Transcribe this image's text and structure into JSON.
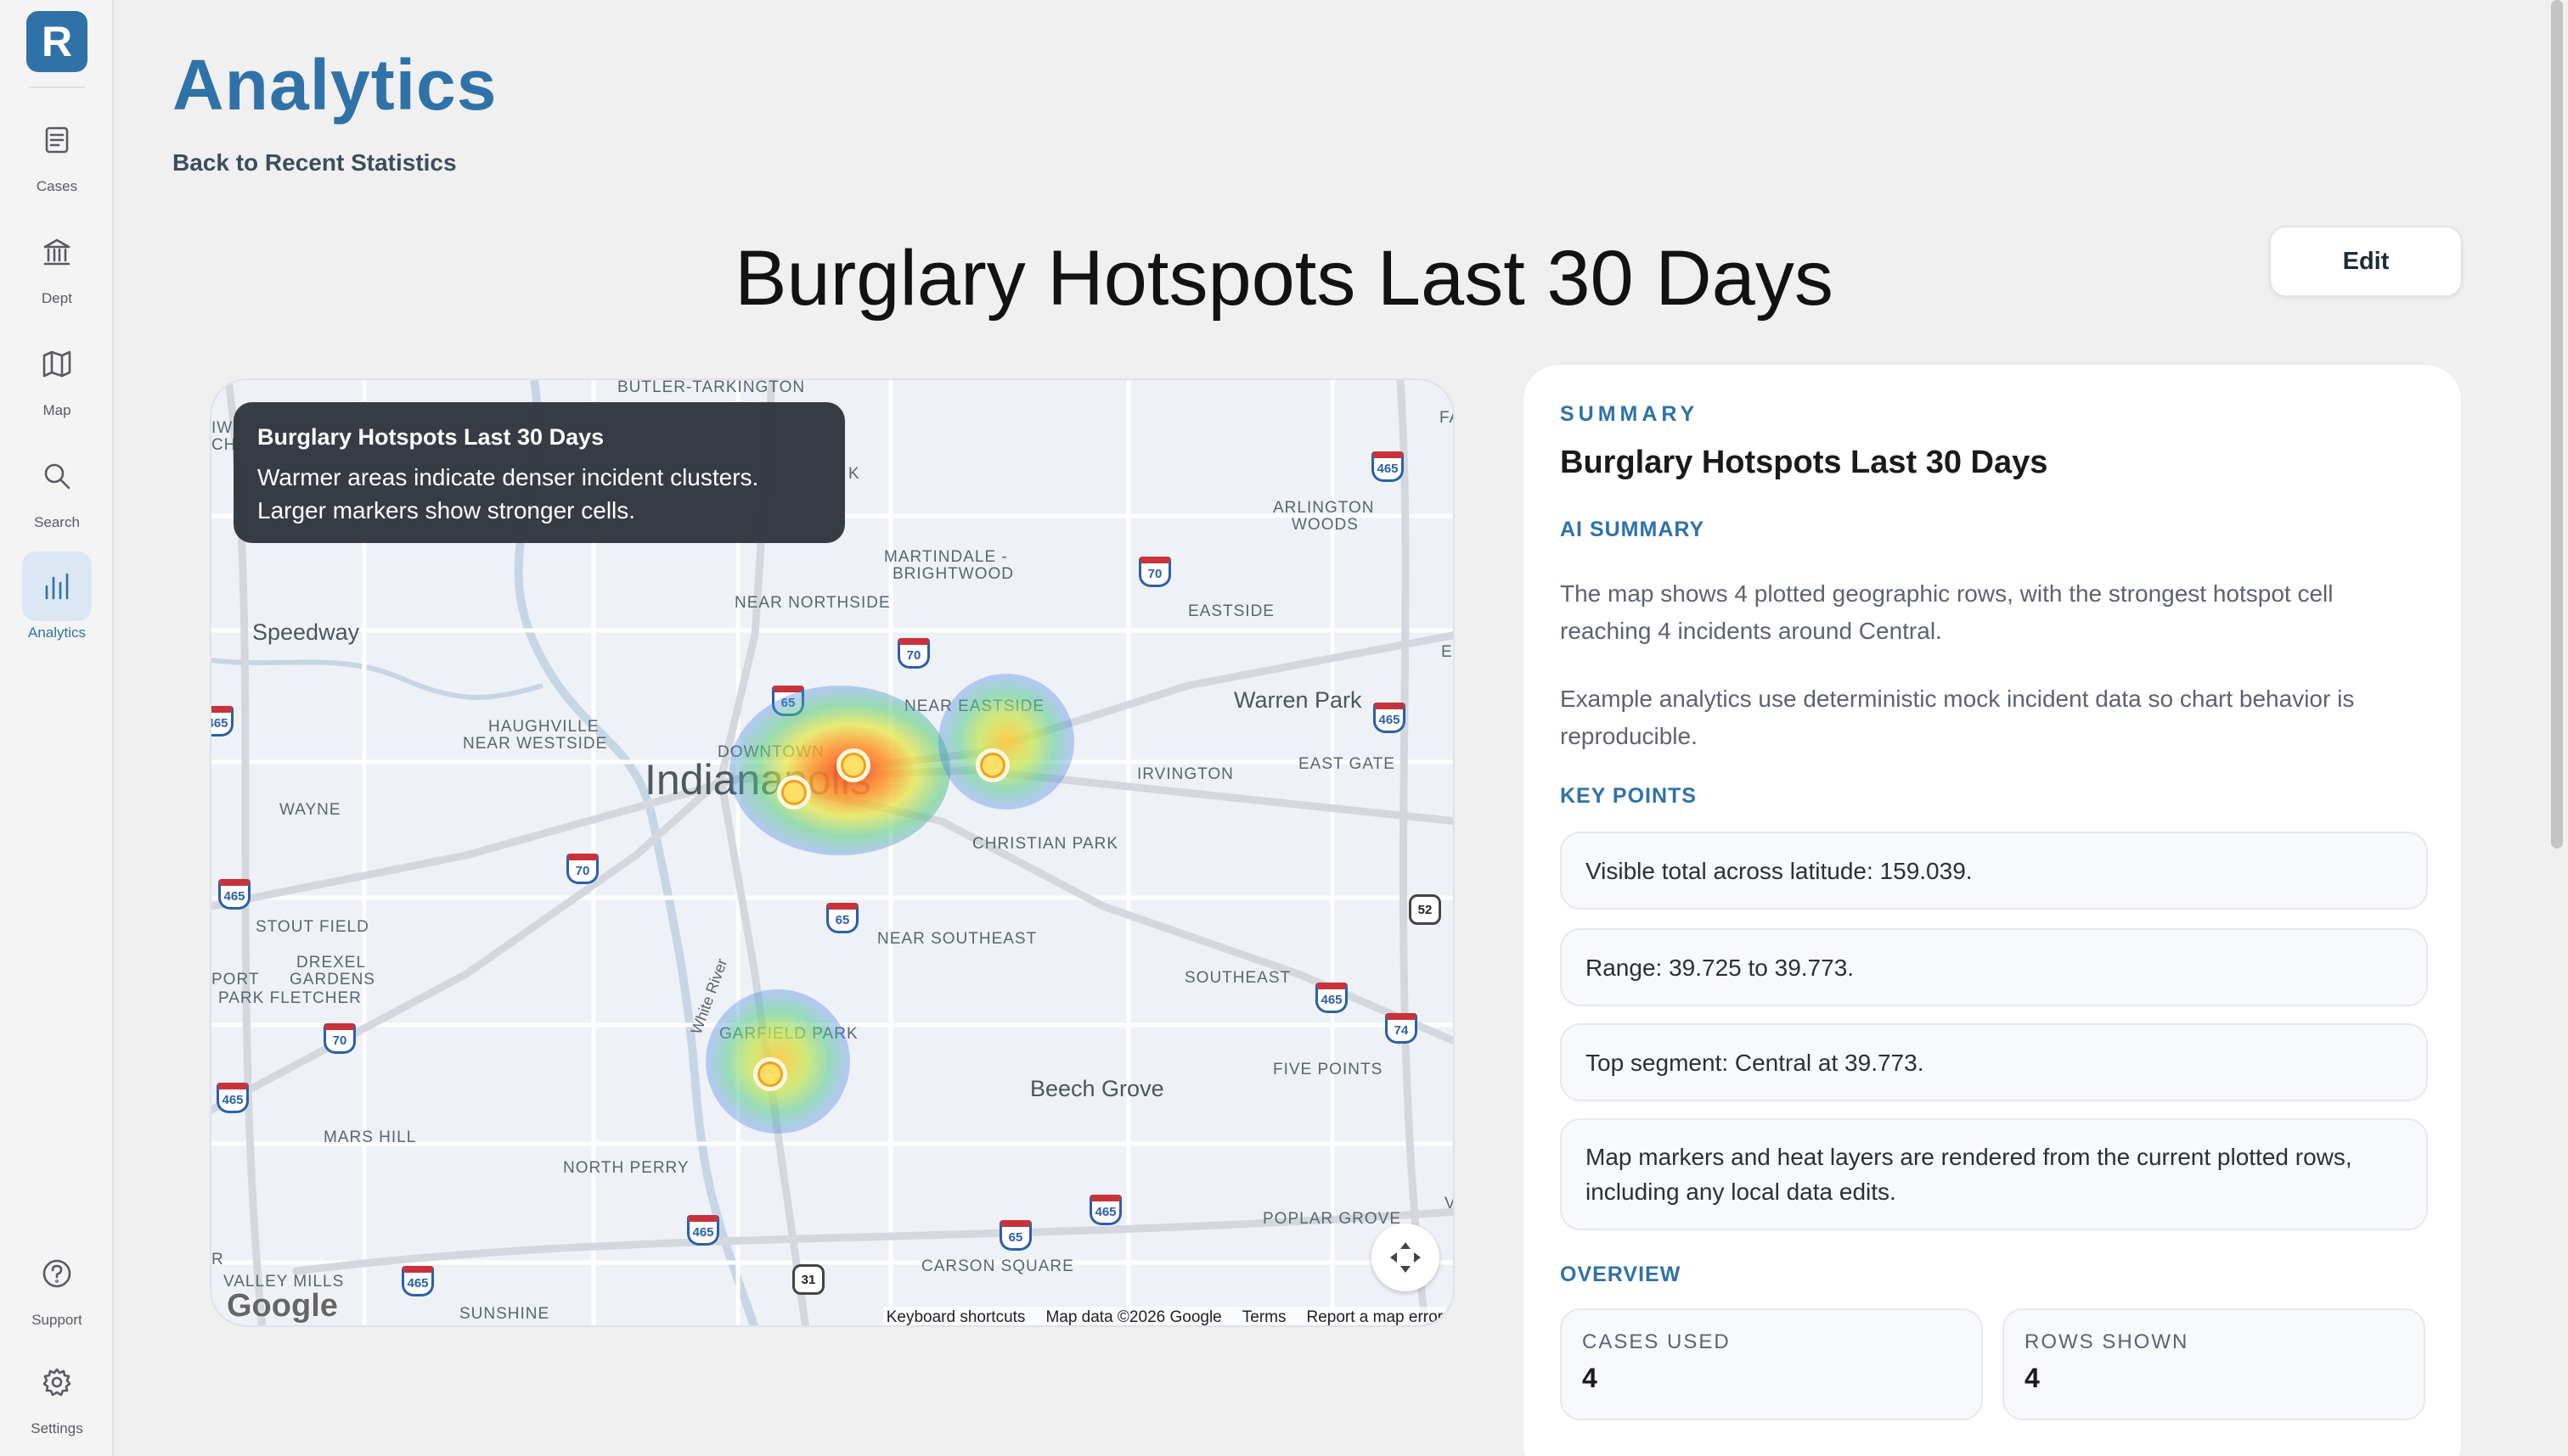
{
  "sidebar": {
    "logo": "R",
    "items": [
      {
        "label": "Cases",
        "icon": "document-icon"
      },
      {
        "label": "Dept",
        "icon": "bank-icon"
      },
      {
        "label": "Map",
        "icon": "map-icon"
      },
      {
        "label": "Search",
        "icon": "search-icon"
      },
      {
        "label": "Analytics",
        "icon": "bar-chart-icon",
        "active": true
      },
      {
        "label": "Support",
        "icon": "help-icon"
      },
      {
        "label": "Settings",
        "icon": "gear-icon"
      }
    ]
  },
  "header": {
    "title": "Analytics",
    "back_link": "Back to Recent Statistics",
    "report_title": "Burglary Hotspots Last 30 Days",
    "edit_label": "Edit"
  },
  "map": {
    "tooltip_title": "Burglary Hotspots Last 30 Days",
    "tooltip_line1": "Warmer areas indicate denser incident clusters.",
    "tooltip_line2": "Larger markers show stronger cells.",
    "labels": {
      "butler": "BUTLER-TARKINGTON",
      "arlington": "ARLINGTON",
      "woods": "WOODS",
      "martindale": "MARTINDALE -",
      "brightwood": "BRIGHTWOOD",
      "eastside": "EASTSIDE",
      "speedway": "Speedway",
      "near_northside": "NEAR NORTHSIDE",
      "near_eastside": "NEAR EASTSIDE",
      "warren_park": "Warren Park",
      "haughville": "HAUGHVILLE",
      "near_westside": "NEAR WESTSIDE",
      "downtown": "DOWNTOWN",
      "indianapolis": "Indianapolis",
      "irvington": "IRVINGTON",
      "east_gate": "EAST GATE",
      "wayne": "WAYNE",
      "christian_park": "CHRISTIAN PARK",
      "stout_field": "STOUT FIELD",
      "drexel": "DREXEL",
      "gardens": "GARDENS",
      "port": "PORT",
      "park_fletcher": "PARK FLETCHER",
      "near_southeast": "NEAR SOUTHEAST",
      "southeast": "SOUTHEAST",
      "white_river": "White River",
      "garfield_park": "GARFIELD PARK",
      "beech_grove": "Beech Grove",
      "five_points": "FIVE POINTS",
      "mars_hill": "MARS HILL",
      "north_perry": "NORTH PERRY",
      "poplar_grove": "POPLAR GROVE",
      "carson_square": "CARSON SQUARE",
      "valley_mills": "VALLEY MILLS",
      "sunshine": "SUNSHINE",
      "edge_iw": "IW",
      "edge_ch": "CH",
      "edge_fa": "FA",
      "edge_e": "E",
      "edge_k": "K",
      "edge_r": "R",
      "edge_v": "V"
    },
    "shields": [
      "465",
      "465",
      "465",
      "465",
      "465",
      "465",
      "465",
      "465",
      "465",
      "465",
      "465",
      "70",
      "70",
      "70",
      "70",
      "65",
      "65",
      "65",
      "74",
      "52",
      "31"
    ],
    "google": "Google",
    "attribution": [
      "Keyboard shortcuts",
      "Map data ©2026 Google",
      "Terms",
      "Report a map error"
    ]
  },
  "summary": {
    "section": "SUMMARY",
    "title": "Burglary Hotspots Last 30 Days",
    "ai_label": "AI SUMMARY",
    "ai_p1": "The map shows 4 plotted geographic rows, with the strongest hotspot cell reaching 4 incidents around Central.",
    "ai_p2": "Example analytics use deterministic mock incident data so chart behavior is reproducible.",
    "key_label": "KEY POINTS",
    "key_points": [
      "Visible total across latitude: 159.039.",
      "Range: 39.725 to 39.773.",
      "Top segment: Central at 39.773.",
      "Map markers and heat layers are rendered from the current plotted rows, including any local data edits."
    ],
    "overview_label": "OVERVIEW",
    "stats": [
      {
        "label": "CASES USED",
        "value": "4"
      },
      {
        "label": "ROWS SHOWN",
        "value": "4"
      }
    ]
  }
}
